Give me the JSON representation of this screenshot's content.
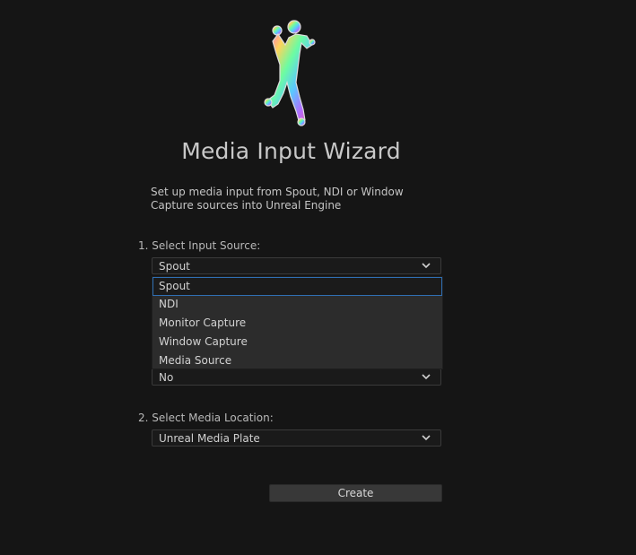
{
  "app": {
    "title": "Media Input Wizard",
    "description": "Set up media input from Spout, NDI or Window Capture sources into Unreal Engine"
  },
  "step1": {
    "label": "1. Select Input Source:",
    "selected": "Spout",
    "options": [
      "Spout",
      "NDI",
      "Monitor Capture",
      "Window Capture",
      "Media Source"
    ],
    "highlighted_option": "Spout"
  },
  "hidden_combo": {
    "selected": "No"
  },
  "step2": {
    "label": "2. Select Media Location:",
    "selected": "Unreal Media Plate"
  },
  "actions": {
    "create_label": "Create"
  },
  "colors": {
    "background": "#151515",
    "highlight": "#2f6fb3"
  },
  "icons": {
    "logo": "dancing-figure-icon",
    "chevron": "chevron-down-icon"
  }
}
